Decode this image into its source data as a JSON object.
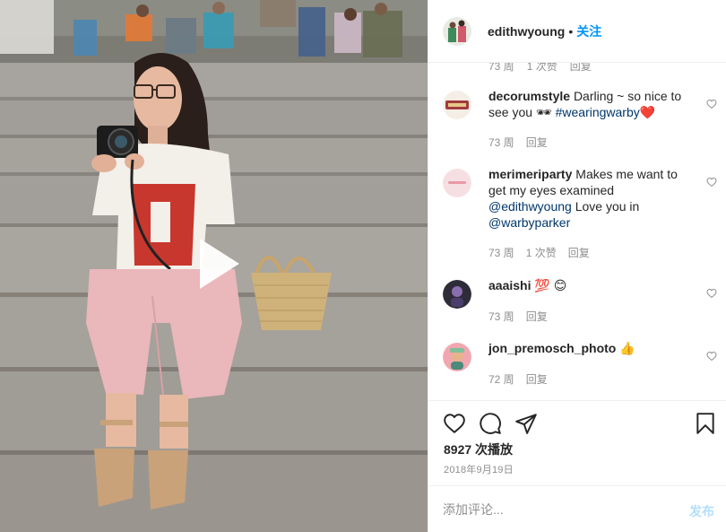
{
  "post": {
    "owner": "edithwyoung",
    "separator": "•",
    "follow_label": "关注",
    "play_icon": "play-icon"
  },
  "hidden_row": {
    "age": "73 周",
    "likes": "1 次赞",
    "reply": "回复"
  },
  "comments": [
    {
      "user": "decorumstyle",
      "text": "Darling ~ so nice to see you 🕶",
      "tag": "#wearingwarby",
      "emoji": "❤️",
      "age": "73 周",
      "reply": "回复"
    },
    {
      "user": "merimeriparty",
      "text": "Makes me want to get my eyes examined",
      "mention1": "@edithwyoung",
      "text2": "Love you in",
      "mention2": "@warbyparker",
      "age": "73 周",
      "likes": "1 次赞",
      "reply": "回复"
    },
    {
      "user": "aaaishi",
      "text": "💯 😊",
      "age": "73 周",
      "reply": "回复"
    },
    {
      "user": "jon_premosch_photo",
      "text": "👍",
      "age": "72 周",
      "reply": "回复"
    }
  ],
  "actions": {
    "like_icon": "heart-icon",
    "comment_icon": "comment-icon",
    "share_icon": "share-icon",
    "save_icon": "bookmark-icon"
  },
  "views": "8927 次播放",
  "date": "2018年9月19日",
  "add_comment": {
    "placeholder": "添加评论...",
    "post_label": "发布"
  },
  "colors": {
    "link": "#00376b",
    "accent": "#0095f6",
    "post_disabled": "#b2dffc",
    "heart": "#ed4956",
    "muted": "#8e8e8e"
  }
}
